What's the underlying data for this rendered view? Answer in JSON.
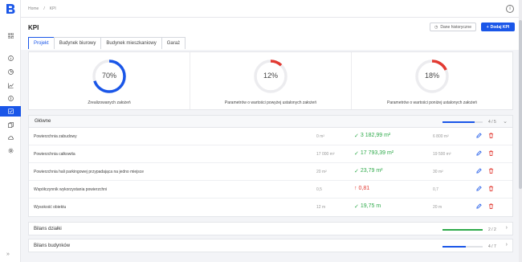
{
  "breadcrumb": {
    "home": "Home",
    "sep": "/",
    "current": "KPI"
  },
  "header": {
    "info_icon": "i"
  },
  "page": {
    "title": "KPI",
    "history_label": "Dane historyczne",
    "add_label": "Dodaj KPI",
    "tabs": [
      "Projekt",
      "Budynek biurowy",
      "Budynek mieszkaniowy",
      "Garaż"
    ],
    "active_tab": "Projekt"
  },
  "summary": [
    {
      "value": "70%",
      "percent": 70,
      "color": "#1a56e8",
      "caption": "Zrealizowanych założeń"
    },
    {
      "value": "12%",
      "percent": 12,
      "color": "#e23a32",
      "caption": "Parametrów o wartości powyżej ustalonych założeń"
    },
    {
      "value": "18%",
      "percent": 18,
      "color": "#e23a32",
      "caption": "Parametrów o wartości poniżej ustalonych założeń"
    }
  ],
  "sections": {
    "main": {
      "title": "Główne",
      "count": "4 / 5",
      "progress": 0.8,
      "color": "#1a56e8",
      "rows": [
        {
          "name": "Powierzchnia zabudowy",
          "base": "0 m²",
          "value": "3 182,99 m²",
          "status": "ok",
          "target": "6 800 m²"
        },
        {
          "name": "Powierzchnia całkowita",
          "base": "17 000 m²",
          "value": "17 793,39 m²",
          "status": "ok",
          "target": "19 500 m²"
        },
        {
          "name": "Powierzchnia hali parkingowej przypadająca na jedno miejsce",
          "base": "20 m²",
          "value": "23,79 m²",
          "status": "ok",
          "target": "30 m²"
        },
        {
          "name": "Współczynnik wykorzystania powierzchni",
          "base": "0,5",
          "value": "0,81",
          "status": "bad",
          "target": "0,7"
        },
        {
          "name": "Wysokość obiektu",
          "base": "12 m",
          "value": "19,75 m",
          "status": "ok",
          "target": "20 m"
        }
      ]
    },
    "plot": {
      "title": "Bilans działki",
      "count": "2 / 2",
      "progress": 1.0,
      "color": "#2eaa4a"
    },
    "buildings": {
      "title": "Bilans budynków",
      "count": "4 / 7",
      "progress": 0.57,
      "color": "#1a56e8"
    }
  },
  "icons": {
    "check": "✓",
    "arrow_up": "↑",
    "chevron_down": "⌄",
    "chevron_right": "›",
    "collapse": "»",
    "plus": "+",
    "clock": "◷"
  },
  "colors": {
    "accent": "#1a56e8",
    "success": "#2eaa4a",
    "danger": "#e23a32"
  }
}
